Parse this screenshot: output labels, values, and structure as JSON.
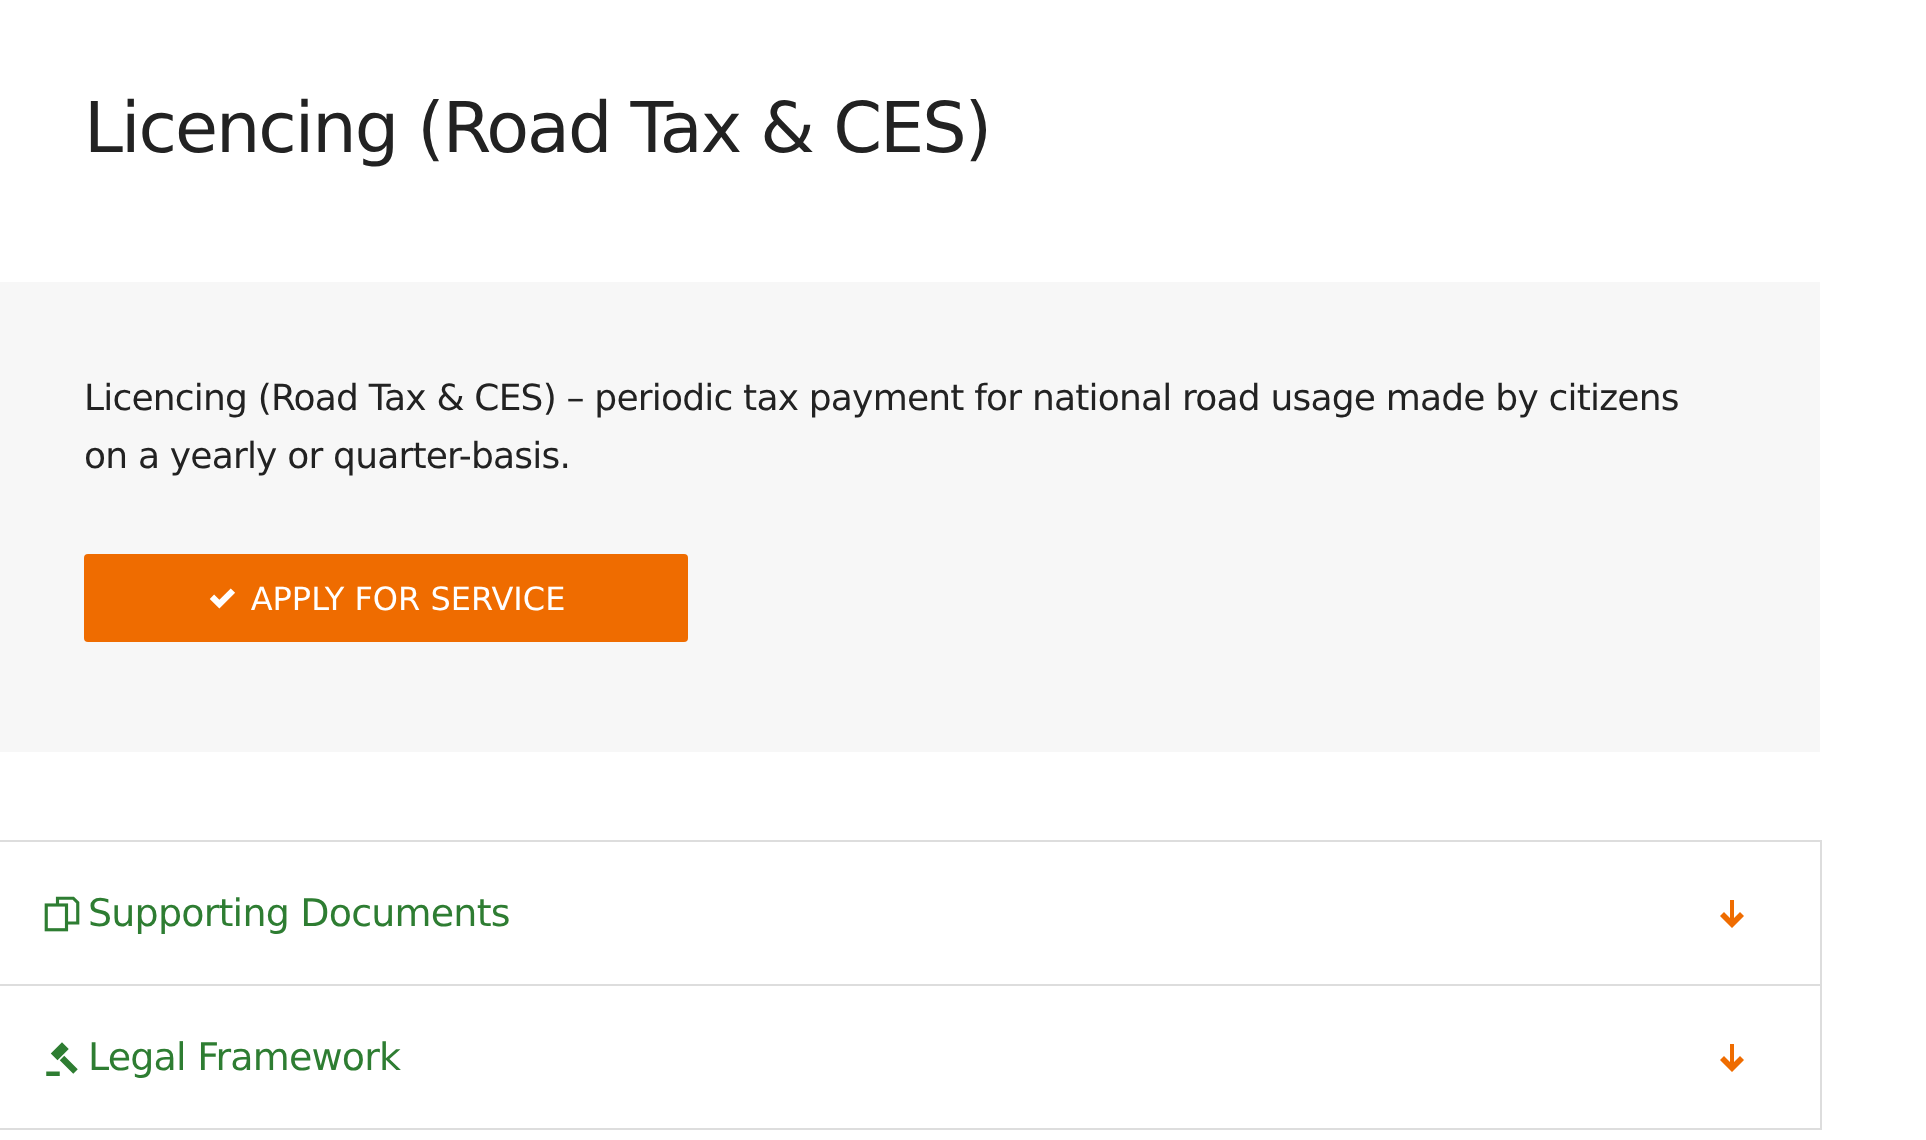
{
  "title": "Licencing (Road Tax & CES)",
  "intro": {
    "description": "Licencing (Road Tax & CES) – periodic tax payment for national road usage made by citizens on a yearly or quarter-basis.",
    "button": "APPLY FOR SERVICE"
  },
  "accordion": [
    {
      "kind": "documents",
      "label": "Supporting Documents",
      "expanded": false
    },
    {
      "kind": "legal",
      "label": "Legal Framework",
      "expanded": false
    }
  ]
}
